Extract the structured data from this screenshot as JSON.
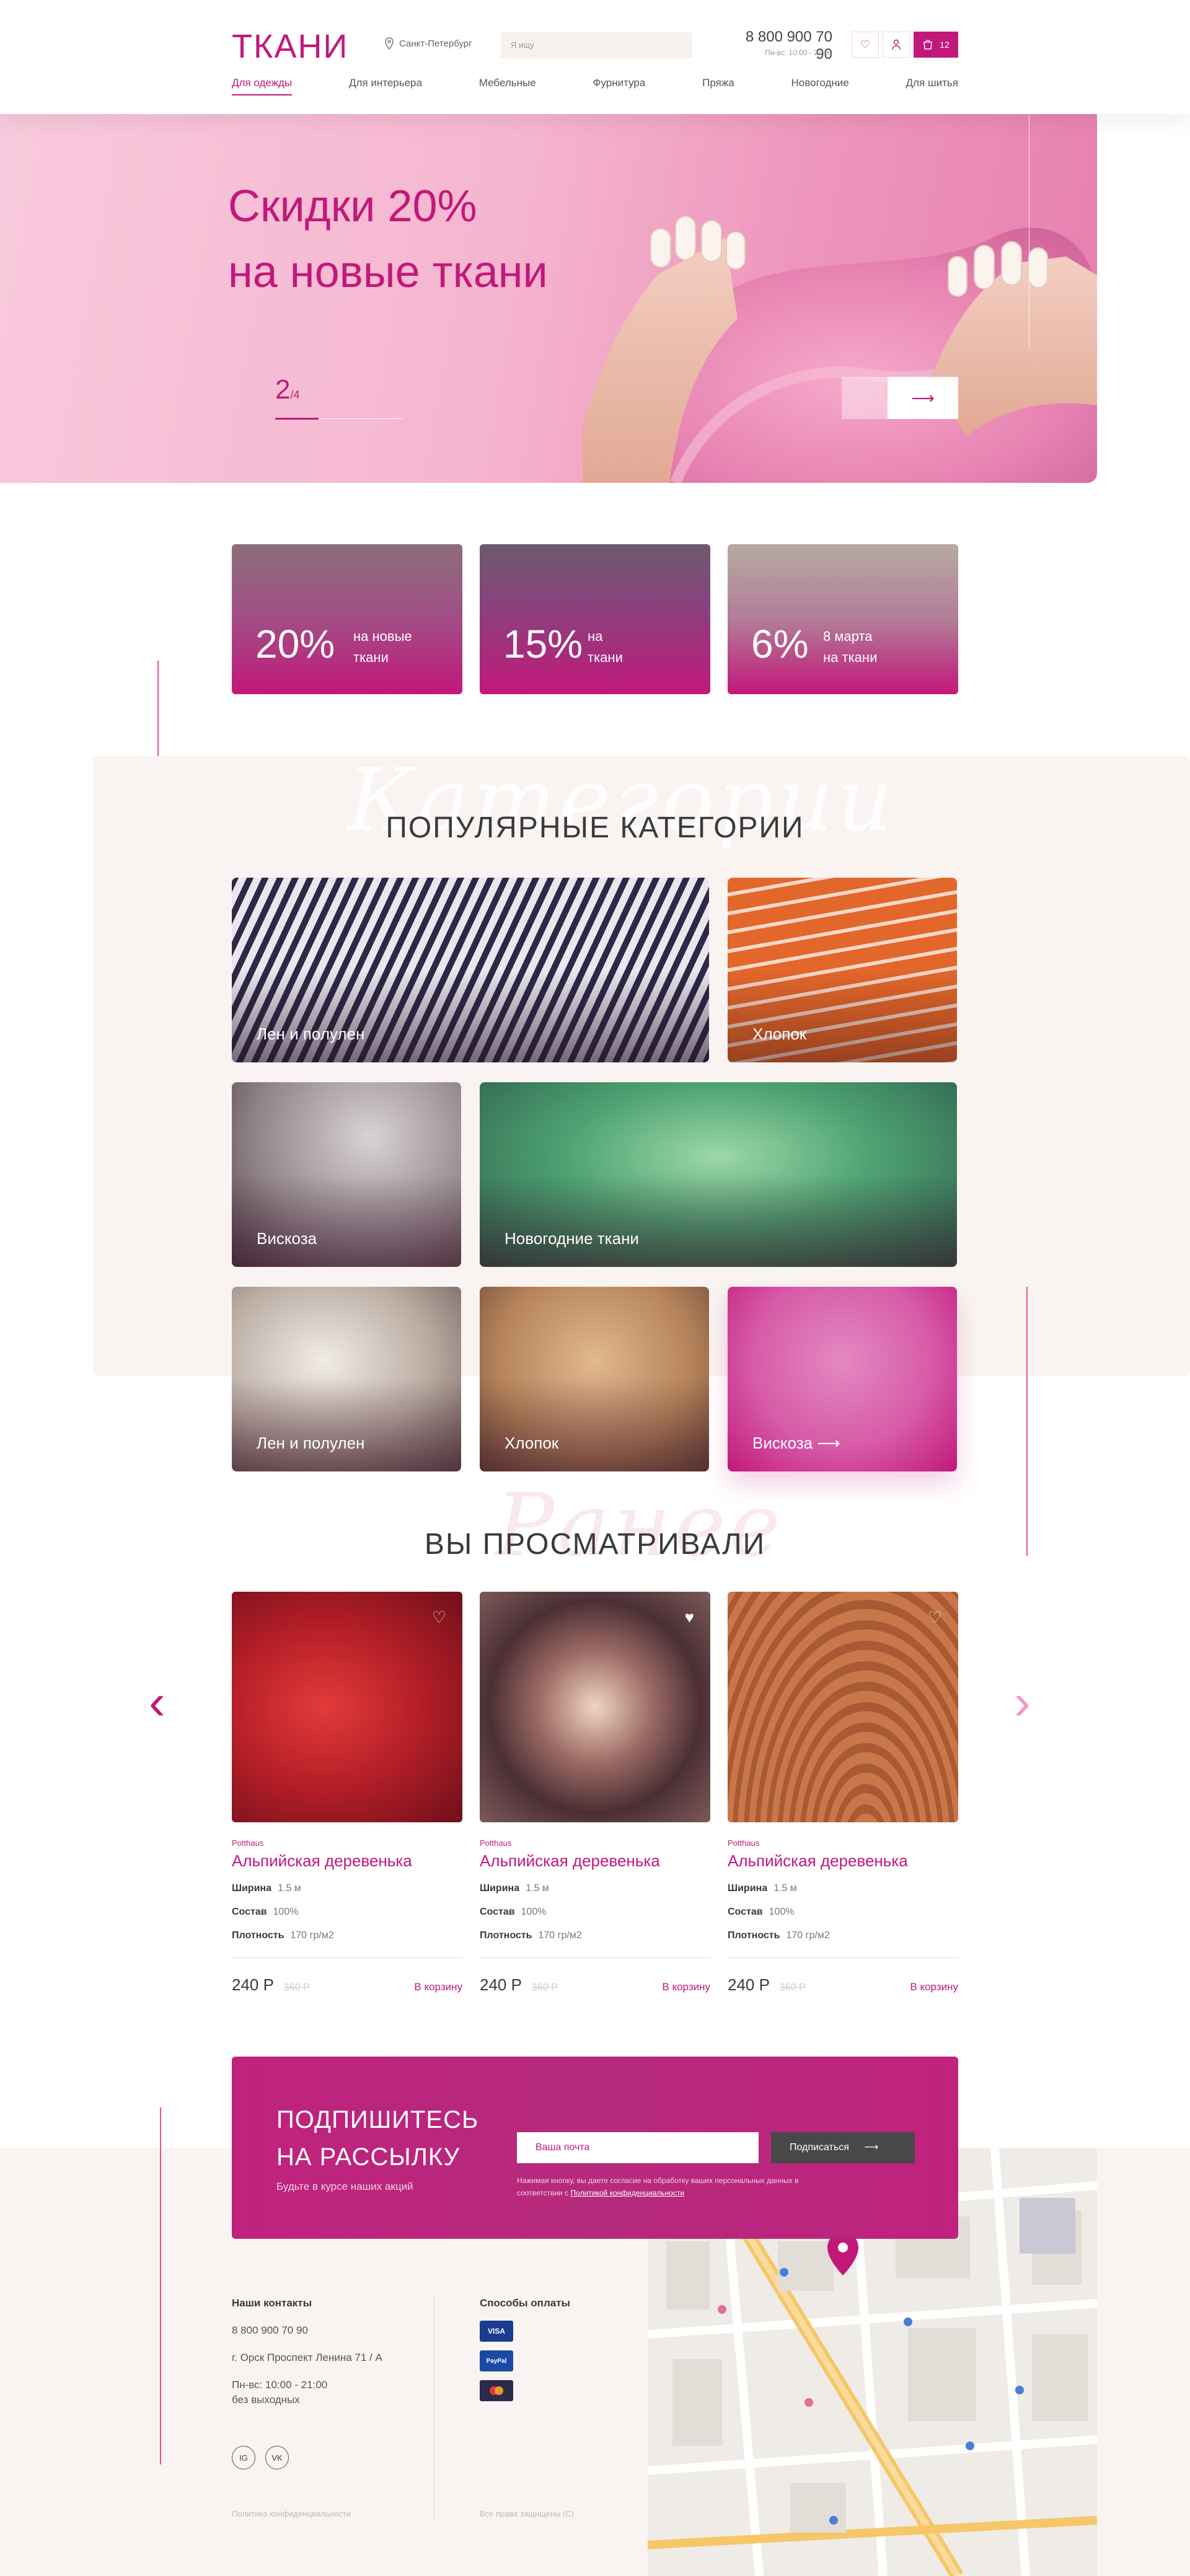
{
  "header": {
    "logo": "ТКАНИ",
    "city": "Санкт-Петербург",
    "search_placeholder": "Я ищу",
    "phone": "8 800 900 70 90",
    "hours": "Пн-вс: 10:00 - 21:00",
    "cart_count": "12",
    "nav": [
      "Для одежды",
      "Для интерьера",
      "Мебельные",
      "Фурнитура",
      "Пряжа",
      "Новогодние",
      "Для шитья"
    ],
    "nav_active": 0
  },
  "hero": {
    "title_line1": "Скидки 20%",
    "title_line2": "на новые ткани",
    "slide_current": "2",
    "slide_total": "/4"
  },
  "promos": [
    {
      "percent": "20%",
      "line1": "на новые",
      "line2": "ткани"
    },
    {
      "percent": "15%",
      "line1": "на",
      "line2": "ткани"
    },
    {
      "percent": "6%",
      "line1": "8 марта",
      "line2": "на ткани"
    }
  ],
  "categories": {
    "ghost": "Категории",
    "title": "ПОПУЛЯРНЫЕ КАТЕГОРИИ",
    "items": [
      "Лен и полулен",
      "Хлопок",
      "Вискоза",
      "Новогодние ткани",
      "Лен и полулен",
      "Хлопок",
      "Вискоза"
    ]
  },
  "viewed": {
    "ghost": "Ранее",
    "title": "ВЫ ПРОСМАТРИВАЛИ",
    "products": [
      {
        "brand": "Potthaus",
        "name": "Альпийская деревенька",
        "width_label": "Ширина",
        "width": "1.5 м",
        "comp_label": "Состав",
        "comp": "100%",
        "dens_label": "Плотность",
        "dens": "170 гр/м2",
        "price": "240 Р",
        "old_price": "360 Р",
        "buy": "В корзину"
      },
      {
        "brand": "Potthaus",
        "name": "Альпийская деревенька",
        "width_label": "Ширина",
        "width": "1.5 м",
        "comp_label": "Состав",
        "comp": "100%",
        "dens_label": "Плотность",
        "dens": "170 гр/м2",
        "price": "240 Р",
        "old_price": "360 Р",
        "buy": "В корзину"
      },
      {
        "brand": "Potthaus",
        "name": "Альпийская деревенька",
        "width_label": "Ширина",
        "width": "1.5 м",
        "comp_label": "Состав",
        "comp": "100%",
        "dens_label": "Плотность",
        "dens": "170 гр/м2",
        "price": "240 Р",
        "old_price": "360 Р",
        "buy": "В корзину"
      }
    ]
  },
  "subscribe": {
    "title_line1": "ПОДПИШИТЕСЬ",
    "title_line2": "НА РАССЫЛКУ",
    "subtitle": "Будьте в курсе наших акций",
    "email_placeholder": "Ваша почта",
    "button": "Подписаться",
    "note": "Нажимая кнопку, вы даете согласие на обработку ваших персональных данных в соответствии с",
    "note_link": "Политикой конфиденциальности"
  },
  "footer": {
    "contacts_title": "Наши контакты",
    "phone": "8 800 900 70 90",
    "address": "г. Орск Проспект Ленина 71 / А",
    "hours1": "Пн-вс: 10:00 - 21:00",
    "hours2": "без выходных",
    "social": [
      "IG",
      "VK"
    ],
    "privacy": "Политика конфиденциальности",
    "payment_title": "Способы оплаты",
    "payments": [
      "VISA",
      "PayPal",
      "MC"
    ],
    "rights": "Все права защищены (C)"
  }
}
